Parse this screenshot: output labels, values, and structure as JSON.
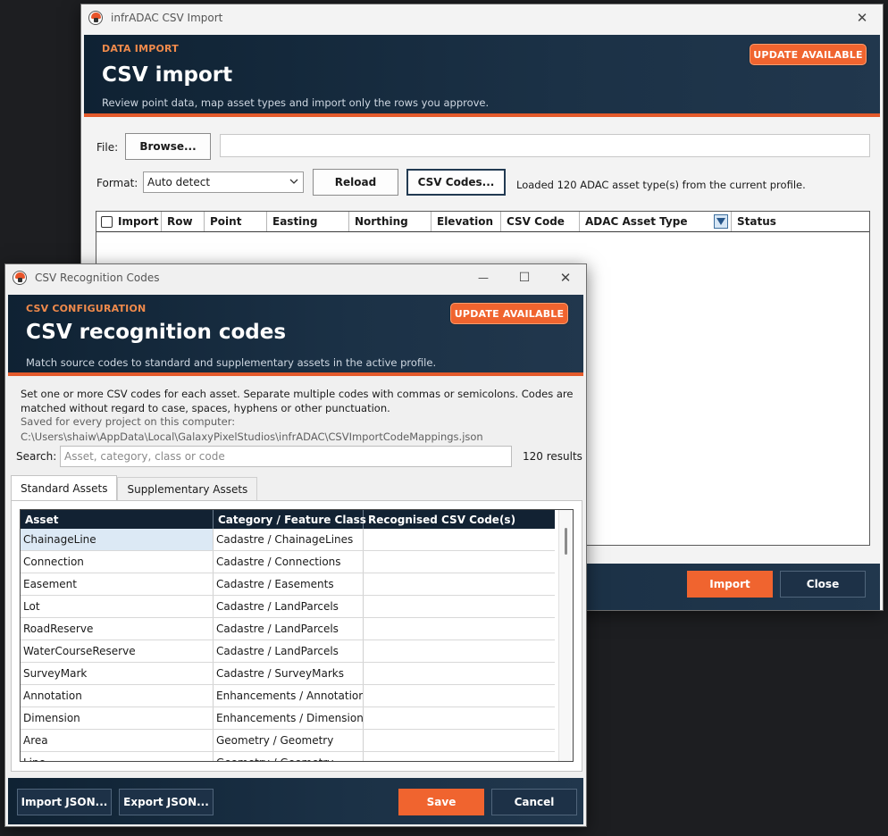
{
  "main_window": {
    "title": "infrADAC CSV Import",
    "close_glyph": "✕",
    "banner": {
      "eyebrow": "DATA IMPORT",
      "title": "CSV import",
      "subtitle": "Review point data, map asset types and import only the rows you approve.",
      "update_label": "UPDATE AVAILABLE"
    },
    "file_label": "File:",
    "browse_label": "Browse...",
    "file_value": "",
    "format_label": "Format:",
    "format_selected": "Auto detect",
    "reload_label": "Reload",
    "csv_codes_label": "CSV Codes...",
    "status_message": "Loaded 120 ADAC asset type(s) from the current profile.",
    "columns": [
      "Import",
      "Row",
      "Point",
      "Easting",
      "Northing",
      "Elevation",
      "CSV Code",
      "ADAC Asset Type",
      "Status"
    ],
    "import_label": "Import",
    "close_label": "Close"
  },
  "codes_window": {
    "title": "CSV Recognition Codes",
    "minimize_glyph": "—",
    "maximize_glyph": "☐",
    "close_glyph": "✕",
    "banner": {
      "eyebrow": "CSV CONFIGURATION",
      "title": "CSV recognition codes",
      "subtitle": "Match source codes to standard and supplementary assets in the active profile.",
      "update_label": "UPDATE AVAILABLE"
    },
    "instructions_line1": "Set one or more CSV codes for each asset. Separate multiple codes with commas or semicolons. Codes are",
    "instructions_line2": "matched without regard to case, spaces, hyphens or other punctuation.",
    "saved_note": "Saved for every project on this computer:",
    "saved_path": "C:\\Users\\shaiw\\AppData\\Local\\GalaxyPixelStudios\\infrADAC\\CSVImportCodeMappings.json",
    "search_label": "Search:",
    "search_placeholder": "Asset, category, class or code",
    "result_count": "120 results",
    "tabs": [
      "Standard Assets",
      "Supplementary Assets"
    ],
    "columns": [
      "Asset",
      "Category / Feature Class",
      "Recognised CSV Code(s)"
    ],
    "rows": [
      {
        "asset": "ChainageLine",
        "category": "Cadastre / ChainageLines",
        "codes": ""
      },
      {
        "asset": "Connection",
        "category": "Cadastre / Connections",
        "codes": ""
      },
      {
        "asset": "Easement",
        "category": "Cadastre / Easements",
        "codes": ""
      },
      {
        "asset": "Lot",
        "category": "Cadastre / LandParcels",
        "codes": ""
      },
      {
        "asset": "RoadReserve",
        "category": "Cadastre / LandParcels",
        "codes": ""
      },
      {
        "asset": "WaterCourseReserve",
        "category": "Cadastre / LandParcels",
        "codes": ""
      },
      {
        "asset": "SurveyMark",
        "category": "Cadastre / SurveyMarks",
        "codes": ""
      },
      {
        "asset": "Annotation",
        "category": "Enhancements / Annotations",
        "codes": ""
      },
      {
        "asset": "Dimension",
        "category": "Enhancements / Dimensions",
        "codes": ""
      },
      {
        "asset": "Area",
        "category": "Geometry / Geometry",
        "codes": ""
      },
      {
        "asset": "Line",
        "category": "Geometry / Geometry",
        "codes": ""
      }
    ],
    "import_json_label": "Import JSON...",
    "export_json_label": "Export JSON...",
    "save_label": "Save",
    "cancel_label": "Cancel"
  }
}
